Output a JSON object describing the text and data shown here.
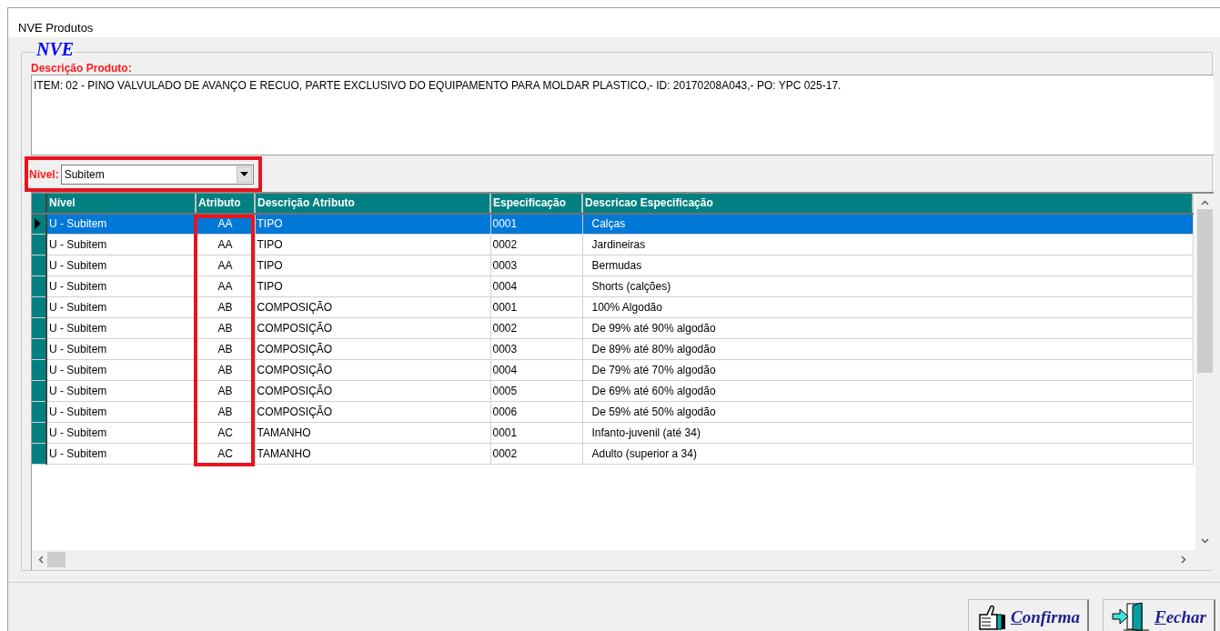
{
  "window": {
    "title": "NVE Produtos"
  },
  "group": {
    "legend": "NVE"
  },
  "description": {
    "label": "Descrição Produto:",
    "value": "ITEM: 02 - PINO VALVULADO DE AVANÇO E RECUO, PARTE EXCLUSIVO DO EQUIPAMENTO PARA MOLDAR PLASTICO,- ID: 20170208A043,- PO: YPC 025-17."
  },
  "level_filter": {
    "label": "Nível:",
    "value": "Subitem",
    "highlighted": true
  },
  "table": {
    "columns": [
      {
        "label": "Nível",
        "highlighted": false
      },
      {
        "label": "Atributo",
        "highlighted": true
      },
      {
        "label": "Descrição Atributo",
        "highlighted": false
      },
      {
        "label": "Especificação",
        "highlighted": false
      },
      {
        "label": "Descricao Especificação",
        "highlighted": false
      }
    ],
    "rows": [
      {
        "cells": [
          "U - Subitem",
          "AA",
          "TIPO",
          "0001",
          "Calças"
        ],
        "selected": true
      },
      {
        "cells": [
          "U - Subitem",
          "AA",
          "TIPO",
          "0002",
          "Jardineiras"
        ],
        "selected": false
      },
      {
        "cells": [
          "U - Subitem",
          "AA",
          "TIPO",
          "0003",
          "Bermudas"
        ],
        "selected": false
      },
      {
        "cells": [
          "U - Subitem",
          "AA",
          "TIPO",
          "0004",
          "Shorts (calções)"
        ],
        "selected": false
      },
      {
        "cells": [
          "U - Subitem",
          "AB",
          "COMPOSIÇÃO",
          "0001",
          "100% Algodão"
        ],
        "selected": false
      },
      {
        "cells": [
          "U - Subitem",
          "AB",
          "COMPOSIÇÃO",
          "0002",
          "De 99% até 90% algodão"
        ],
        "selected": false
      },
      {
        "cells": [
          "U - Subitem",
          "AB",
          "COMPOSIÇÃO",
          "0003",
          "De 89% até 80% algodão"
        ],
        "selected": false
      },
      {
        "cells": [
          "U - Subitem",
          "AB",
          "COMPOSIÇÃO",
          "0004",
          "De 79% até 70% algodão"
        ],
        "selected": false
      },
      {
        "cells": [
          "U - Subitem",
          "AB",
          "COMPOSIÇÃO",
          "0005",
          "De 69% até 60% algodão"
        ],
        "selected": false
      },
      {
        "cells": [
          "U - Subitem",
          "AB",
          "COMPOSIÇÃO",
          "0006",
          "De 59% até 50% algodão"
        ],
        "selected": false
      },
      {
        "cells": [
          "U - Subitem",
          "AC",
          "TAMANHO",
          "0001",
          "Infanto-juvenil (até 34)"
        ],
        "selected": false
      },
      {
        "cells": [
          "U - Subitem",
          "AC",
          "TAMANHO",
          "0002",
          "Adulto (superior a 34)"
        ],
        "selected": false
      }
    ]
  },
  "buttons": [
    {
      "kind": "confirm",
      "label": "Confirma"
    },
    {
      "kind": "close",
      "label": "Fechar"
    }
  ]
}
